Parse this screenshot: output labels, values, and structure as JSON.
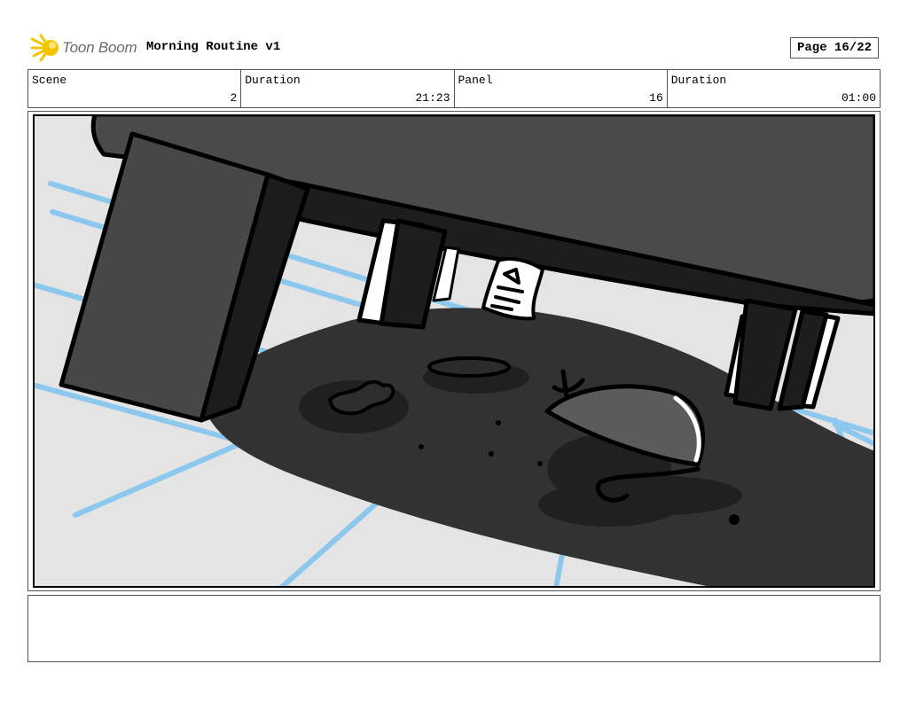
{
  "header": {
    "logo_text": "Toon Boom",
    "document_title": "Morning Routine v1",
    "page_label": "Page 16/22"
  },
  "info": {
    "scene_label": "Scene",
    "scene_value": "2",
    "scene_duration_label": "Duration",
    "scene_duration_value": "21:23",
    "panel_label": "Panel",
    "panel_value": "16",
    "panel_duration_label": "Duration",
    "panel_duration_value": "01:00"
  },
  "notes": {
    "text": ""
  },
  "colors": {
    "floor": "#e4e4e4",
    "tile_lines": "#8cc8ee",
    "shadow": "#323232",
    "furniture_dark": "#1c1c1c",
    "furniture_mid": "#474747",
    "logo_yellow": "#f5c400"
  }
}
